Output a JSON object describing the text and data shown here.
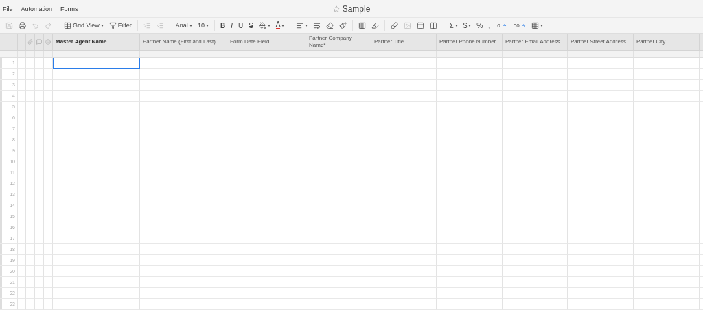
{
  "menu": [
    "File",
    "Automation",
    "Forms"
  ],
  "title": {
    "text": "Sample",
    "favorite": false
  },
  "toolbar": [
    [
      {
        "kind": "icon",
        "disabled": true
      },
      {
        "kind": "icon",
        "disabled": false
      },
      {
        "kind": "icon",
        "disabled": true
      },
      {
        "kind": "icon",
        "disabled": true
      }
    ],
    [
      {
        "kind": "button",
        "label": "Grid View",
        "caret": true
      },
      {
        "kind": "button",
        "label": "Filter",
        "caret": false
      }
    ],
    [
      {
        "kind": "icon",
        "disabled": true
      },
      {
        "kind": "icon",
        "disabled": true
      }
    ],
    [
      {
        "kind": "dropdown",
        "label": "Arial"
      },
      {
        "kind": "dropdown",
        "label": "10"
      }
    ],
    [
      {
        "kind": "bold",
        "label": "B"
      },
      {
        "kind": "italic",
        "label": "I"
      },
      {
        "kind": "underline",
        "label": "U"
      },
      {
        "kind": "strike",
        "label": "S"
      },
      {
        "kind": "icon",
        "disabled": false,
        "caret": true
      },
      {
        "kind": "color",
        "label": "A",
        "caret": true
      }
    ],
    [
      {
        "kind": "icon",
        "disabled": false,
        "caret": true
      },
      {
        "kind": "icon",
        "disabled": false
      },
      {
        "kind": "icon",
        "disabled": false
      },
      {
        "kind": "icon",
        "disabled": false
      }
    ],
    [
      {
        "kind": "icon",
        "disabled": false
      },
      {
        "kind": "icon",
        "disabled": false
      }
    ],
    [
      {
        "kind": "icon",
        "disabled": false
      },
      {
        "kind": "icon",
        "disabled": true
      },
      {
        "kind": "icon",
        "disabled": false
      },
      {
        "kind": "icon",
        "disabled": false
      }
    ],
    [
      {
        "kind": "glyph",
        "label": "Σ",
        "caret": true
      },
      {
        "kind": "glyph",
        "label": "$",
        "caret": true
      },
      {
        "kind": "glyph",
        "label": "%"
      },
      {
        "kind": "bold",
        "label": ","
      },
      {
        "kind": "decimal",
        "label": ".0"
      },
      {
        "kind": "decimal",
        "label": ".00"
      },
      {
        "kind": "icon",
        "disabled": false,
        "caret": true
      }
    ]
  ],
  "columns": [
    {
      "name": "Master Agent Name",
      "primary": true
    },
    {
      "name": "Partner Name (First and Last)",
      "primary": false
    },
    {
      "name": "Form Date Field",
      "primary": false
    },
    {
      "name": "Partner Company Name*",
      "primary": false
    },
    {
      "name": "Partner Title",
      "primary": false
    },
    {
      "name": "Partner Phone Number",
      "primary": false
    },
    {
      "name": "Partner Email Address",
      "primary": false
    },
    {
      "name": "Partner Street Address",
      "primary": false
    },
    {
      "name": "Partner City",
      "primary": false
    }
  ],
  "rows": [
    {
      "number": "1",
      "selected": true
    },
    {
      "number": "2",
      "selected": false
    },
    {
      "number": "3",
      "selected": false
    },
    {
      "number": "4",
      "selected": false
    },
    {
      "number": "5",
      "selected": false
    },
    {
      "number": "6",
      "selected": false
    },
    {
      "number": "7",
      "selected": false
    },
    {
      "number": "8",
      "selected": false
    },
    {
      "number": "9",
      "selected": false
    },
    {
      "number": "10",
      "selected": false
    },
    {
      "number": "11",
      "selected": false
    },
    {
      "number": "12",
      "selected": false
    },
    {
      "number": "13",
      "selected": false
    },
    {
      "number": "14",
      "selected": false
    },
    {
      "number": "15",
      "selected": false
    },
    {
      "number": "16",
      "selected": false
    },
    {
      "number": "17",
      "selected": false
    },
    {
      "number": "18",
      "selected": false
    },
    {
      "number": "19",
      "selected": false
    },
    {
      "number": "20",
      "selected": false
    },
    {
      "number": "21",
      "selected": false
    },
    {
      "number": "22",
      "selected": false
    },
    {
      "number": "23",
      "selected": false
    }
  ]
}
